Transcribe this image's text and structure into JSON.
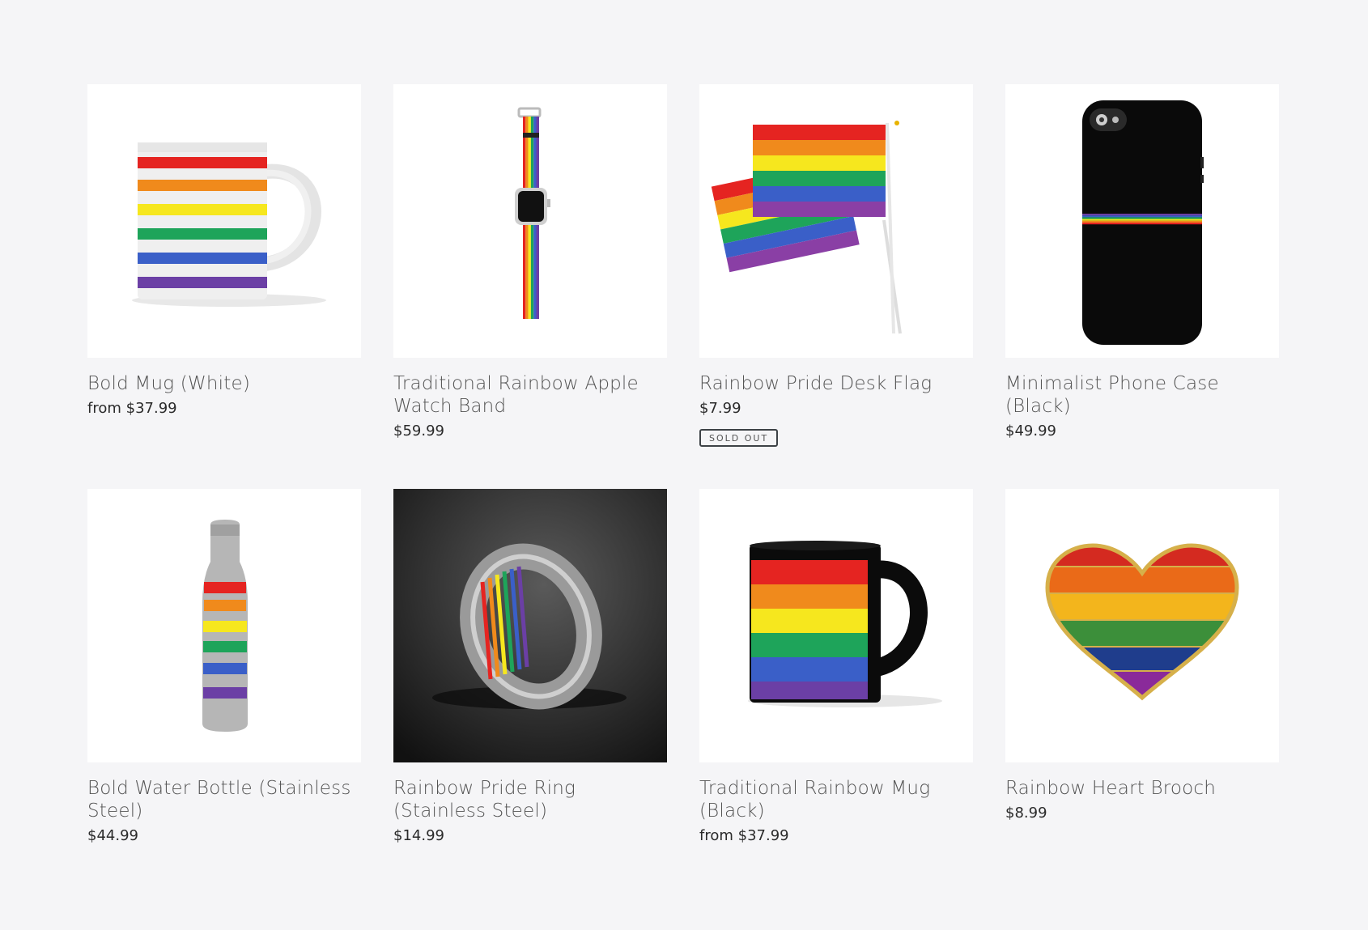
{
  "products": [
    {
      "title": "Bold Mug (White)",
      "price": "from $37.99",
      "image": "rainbow-striped-white-mug"
    },
    {
      "title": "Traditional Rainbow Apple Watch Band",
      "price": "$59.99",
      "image": "rainbow-watch-band"
    },
    {
      "title": "Rainbow Pride Desk Flag",
      "price": "$7.99",
      "badge": "SOLD OUT",
      "image": "rainbow-desk-flags"
    },
    {
      "title": "Minimalist Phone Case (Black)",
      "price": "$49.99",
      "image": "black-phone-case-rainbow-stripe"
    },
    {
      "title": "Bold Water Bottle (Stainless Steel)",
      "price": "$44.99",
      "image": "striped-water-bottle"
    },
    {
      "title": "Rainbow Pride Ring (Stainless Steel)",
      "price": "$14.99",
      "image": "steel-ring-rainbow-inlay"
    },
    {
      "title": "Traditional Rainbow Mug (Black)",
      "price": "from $37.99",
      "image": "black-mug-rainbow-print"
    },
    {
      "title": "Rainbow Heart Brooch",
      "price": "$8.99",
      "image": "rainbow-heart-enamel-pin"
    }
  ],
  "colors": {
    "red": "#e52421",
    "orange": "#f08a1c",
    "yellow": "#f6e71e",
    "green": "#1ea45a",
    "blue": "#3a5fc8",
    "purple": "#6b3fa5"
  }
}
